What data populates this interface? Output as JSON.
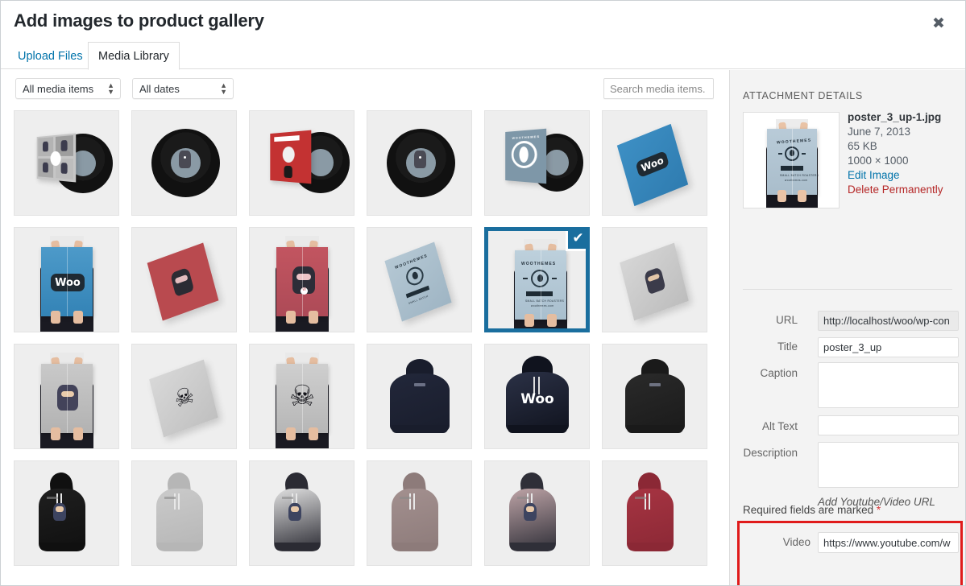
{
  "modal": {
    "title": "Add images to product gallery",
    "close_icon": "close-icon",
    "close_glyph": "✖"
  },
  "tabs": [
    {
      "label": "Upload Files",
      "active": false
    },
    {
      "label": "Media Library",
      "active": true
    }
  ],
  "toolbar": {
    "filter_type": "All media items",
    "filter_dates": "All dates",
    "search_placeholder": "Search media items.",
    "search_value": "",
    "select_arrow_up": "▲",
    "select_arrow_down": "▼"
  },
  "grid": {
    "selected_index": 10,
    "check_glyph": "✔",
    "items": [
      {
        "name": "vinyl-record-sleeve-4up-ninja",
        "alt": "Vinyl record with 4-up ninja sleeve"
      },
      {
        "name": "vinyl-record-ninja-label",
        "alt": "Black vinyl record with ninja label"
      },
      {
        "name": "vinyl-record-red-sleeve",
        "alt": "Vinyl record in red Woothemes sleeve"
      },
      {
        "name": "vinyl-record-ninja-label-2",
        "alt": "Black vinyl record with ninja label"
      },
      {
        "name": "vinyl-record-blue-sleeve",
        "alt": "Vinyl record in blue Woothemes sleeve"
      },
      {
        "name": "blue-woo-flat-poster",
        "alt": "Blue flat poster with Woo logo"
      },
      {
        "name": "woo-poster-held-blue",
        "alt": "Person holding blue Woo poster"
      },
      {
        "name": "ninja-poster-flat-red",
        "alt": "Red flat poster with ninja"
      },
      {
        "name": "ninja-poster-held-red",
        "alt": "Person holding red ninja poster"
      },
      {
        "name": "woothemes-poster-flat-blue",
        "alt": "Blue-grey flat Woothemes poster"
      },
      {
        "name": "woothemes-poster-held-blue",
        "alt": "Person holding Woothemes poster"
      },
      {
        "name": "ninja-poster-flat-grey",
        "alt": "Grey flat poster with ninja"
      },
      {
        "name": "ninja-poster-held-grey",
        "alt": "Person holding grey ninja poster"
      },
      {
        "name": "skull-poster-flat-grey",
        "alt": "Grey flat poster with skull"
      },
      {
        "name": "skull-poster-held-grey",
        "alt": "Person holding grey skull poster"
      },
      {
        "name": "hoodie-navy-back",
        "alt": "Navy hoodie back view"
      },
      {
        "name": "hoodie-navy-woo-front",
        "alt": "Navy Woo hoodie front view"
      },
      {
        "name": "hoodie-black-back",
        "alt": "Black hoodie back view"
      },
      {
        "name": "hoodie-black-side",
        "alt": "Black hoodie side view"
      },
      {
        "name": "hoodie-light-grey-side",
        "alt": "Light grey hoodie side view"
      },
      {
        "name": "hoodie-white-ninja-side",
        "alt": "White ninja hoodie side view"
      },
      {
        "name": "hoodie-mauve-side",
        "alt": "Mauve hoodie side view"
      },
      {
        "name": "hoodie-pink-ninja-side",
        "alt": "Pink ninja hoodie side view"
      },
      {
        "name": "hoodie-red-side",
        "alt": "Red hoodie side view"
      }
    ]
  },
  "details": {
    "heading": "ATTACHMENT DETAILS",
    "filename": "poster_3_up-1.jpg",
    "date": "June 7, 2013",
    "filesize": "65 KB",
    "dimensions": "1000 × 1000",
    "edit_image_label": "Edit Image",
    "delete_label": "Delete Permanently",
    "fields": {
      "url_label": "URL",
      "url_value": "http://localhost/woo/wp-con",
      "title_label": "Title",
      "title_value": "poster_3_up",
      "caption_label": "Caption",
      "caption_value": "",
      "alt_text_label": "Alt Text",
      "alt_text_value": "",
      "description_label": "Description",
      "description_value": ""
    },
    "required_note": "Required fields are marked",
    "required_star": "*",
    "video_label": "Video",
    "video_value": "https://www.youtube.com/w",
    "video_hint": "Add Youtube/Video URL"
  },
  "colors": {
    "accent_blue": "#0073aa",
    "selected_border": "#1a6e9e",
    "delete_red": "#b52727",
    "highlight_red": "#e01b1b",
    "panel_bg": "#f3f3f3",
    "tile_bg": "#eeeeee"
  }
}
